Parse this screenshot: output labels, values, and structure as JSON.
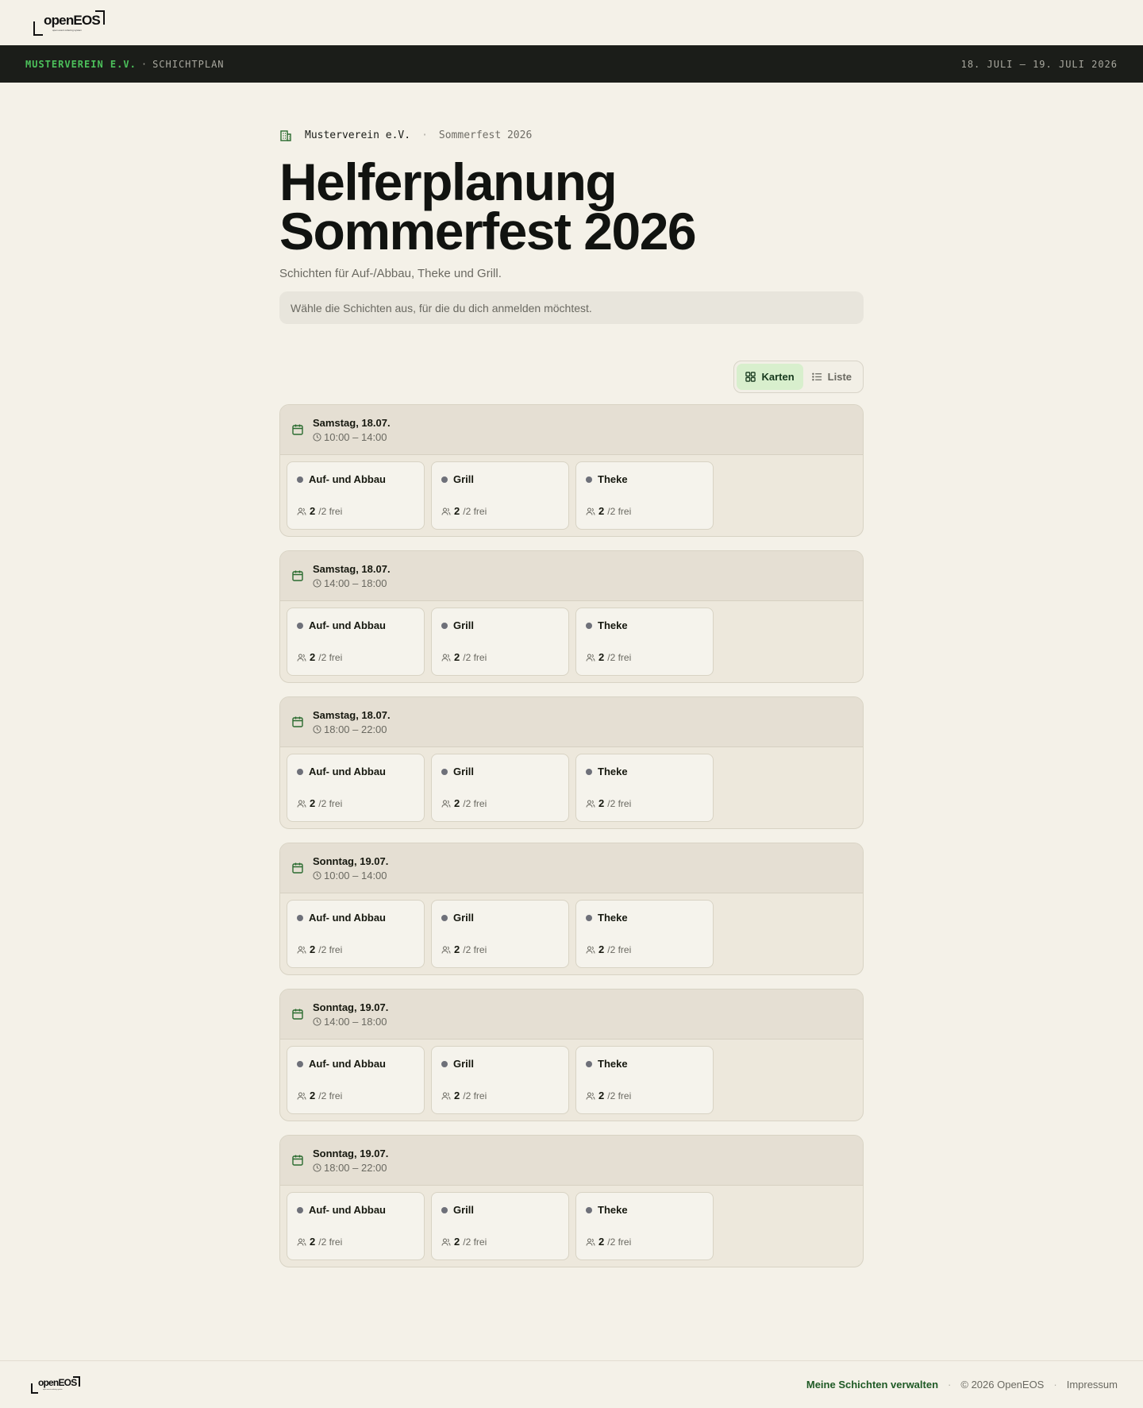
{
  "brand": {
    "logo_text": "openEOS",
    "logo_sub": "open event ordering system"
  },
  "band": {
    "org": "MUSTERVEREIN E.V.",
    "separator": "·",
    "section": "SCHICHTPLAN",
    "dates": "18. JULI – 19. JULI 2026"
  },
  "breadcrumb": {
    "org": "Musterverein e.V.",
    "separator": "·",
    "event": "Sommerfest 2026"
  },
  "page": {
    "title_line1": "Helferplanung",
    "title_line2": "Sommerfest 2026",
    "subtitle": "Schichten für Auf-/Abbau, Theke und Grill.",
    "hint": "Wähle die Schichten aus, für die du dich anmelden möchtest."
  },
  "view_toggle": {
    "cards_label": "Karten",
    "list_label": "Liste",
    "active": "Karten"
  },
  "colors": {
    "accent": "#4cc15b",
    "active_toggle_bg": "#d8efcd",
    "calendar_icon": "#2a6b2f",
    "status_dot": "#6e7079"
  },
  "slots": [
    {
      "date": "Samstag, 18.07.",
      "time": "10:00 – 14:00",
      "shifts": [
        {
          "name": "Auf- und Abbau",
          "free": "2",
          "total": "/2 frei"
        },
        {
          "name": "Grill",
          "free": "2",
          "total": "/2 frei"
        },
        {
          "name": "Theke",
          "free": "2",
          "total": "/2 frei"
        }
      ]
    },
    {
      "date": "Samstag, 18.07.",
      "time": "14:00 – 18:00",
      "shifts": [
        {
          "name": "Auf- und Abbau",
          "free": "2",
          "total": "/2 frei"
        },
        {
          "name": "Grill",
          "free": "2",
          "total": "/2 frei"
        },
        {
          "name": "Theke",
          "free": "2",
          "total": "/2 frei"
        }
      ]
    },
    {
      "date": "Samstag, 18.07.",
      "time": "18:00 – 22:00",
      "shifts": [
        {
          "name": "Auf- und Abbau",
          "free": "2",
          "total": "/2 frei"
        },
        {
          "name": "Grill",
          "free": "2",
          "total": "/2 frei"
        },
        {
          "name": "Theke",
          "free": "2",
          "total": "/2 frei"
        }
      ]
    },
    {
      "date": "Sonntag, 19.07.",
      "time": "10:00 – 14:00",
      "shifts": [
        {
          "name": "Auf- und Abbau",
          "free": "2",
          "total": "/2 frei"
        },
        {
          "name": "Grill",
          "free": "2",
          "total": "/2 frei"
        },
        {
          "name": "Theke",
          "free": "2",
          "total": "/2 frei"
        }
      ]
    },
    {
      "date": "Sonntag, 19.07.",
      "time": "14:00 – 18:00",
      "shifts": [
        {
          "name": "Auf- und Abbau",
          "free": "2",
          "total": "/2 frei"
        },
        {
          "name": "Grill",
          "free": "2",
          "total": "/2 frei"
        },
        {
          "name": "Theke",
          "free": "2",
          "total": "/2 frei"
        }
      ]
    },
    {
      "date": "Sonntag, 19.07.",
      "time": "18:00 – 22:00",
      "shifts": [
        {
          "name": "Auf- und Abbau",
          "free": "2",
          "total": "/2 frei"
        },
        {
          "name": "Grill",
          "free": "2",
          "total": "/2 frei"
        },
        {
          "name": "Theke",
          "free": "2",
          "total": "/2 frei"
        }
      ]
    }
  ],
  "footer": {
    "manage_link": "Meine Schichten verwalten",
    "separator": "·",
    "copyright": "© 2026 OpenEOS",
    "imprint": "Impressum"
  }
}
